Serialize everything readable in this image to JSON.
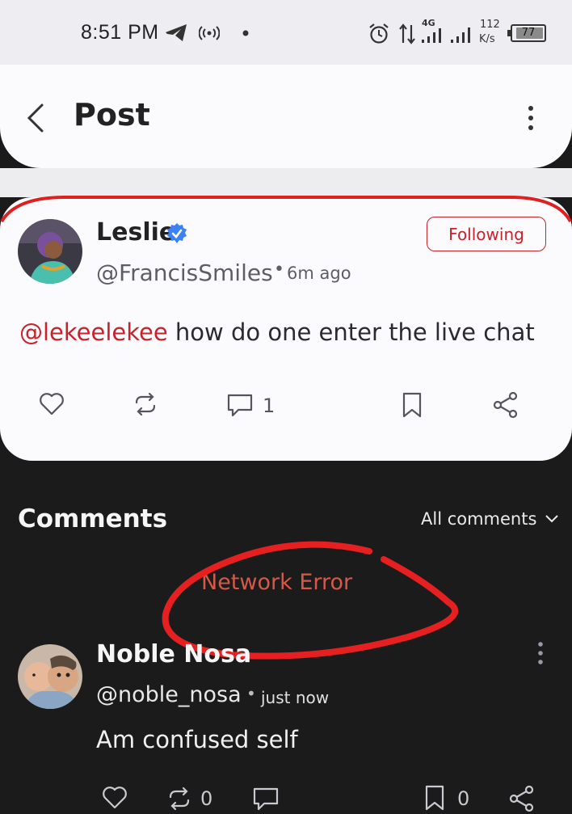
{
  "status_bar": {
    "time": "8:51 PM",
    "network_type": "4G",
    "speed_value": "112",
    "speed_unit": "K/s",
    "battery": "77",
    "icons": [
      "telegram-icon",
      "hotspot-icon",
      "dot-icon",
      "alarm-icon",
      "data-arrows-icon",
      "signal-icon",
      "signal-icon-2",
      "battery-icon"
    ]
  },
  "header": {
    "title": "Post",
    "back_icon": "chevron-left-icon",
    "menu_icon": "more-vertical-icon"
  },
  "post": {
    "author_name": "Leslie",
    "verified_icon": "verified-badge-icon",
    "handle": "@FrancisSmiles",
    "separator": "•",
    "time": "6m ago",
    "follow_label": "Following",
    "mention": "@lekeelekee",
    "text": " how do one enter the live chat",
    "actions": {
      "like_icon": "heart-icon",
      "repost_icon": "repost-icon",
      "comment_icon": "comment-icon",
      "comment_count": "1",
      "bookmark_icon": "bookmark-icon",
      "share_icon": "share-icon"
    }
  },
  "comments": {
    "title": "Comments",
    "filter_label": "All comments",
    "filter_icon": "chevron-down-icon",
    "error_text": "Network Error",
    "items": [
      {
        "name": "Noble Nosa",
        "handle": "@noble_nosa",
        "separator": "•",
        "time": "just now",
        "text": "Am confused self",
        "repost_count": "0",
        "bookmark_count": "0"
      }
    ]
  },
  "colors": {
    "accent_red": "#c8222b",
    "error_orange": "#d35a47",
    "verified_blue": "#3b82f6",
    "dark_bg": "#1b1b1c",
    "card_bg": "#fbfbfd"
  }
}
